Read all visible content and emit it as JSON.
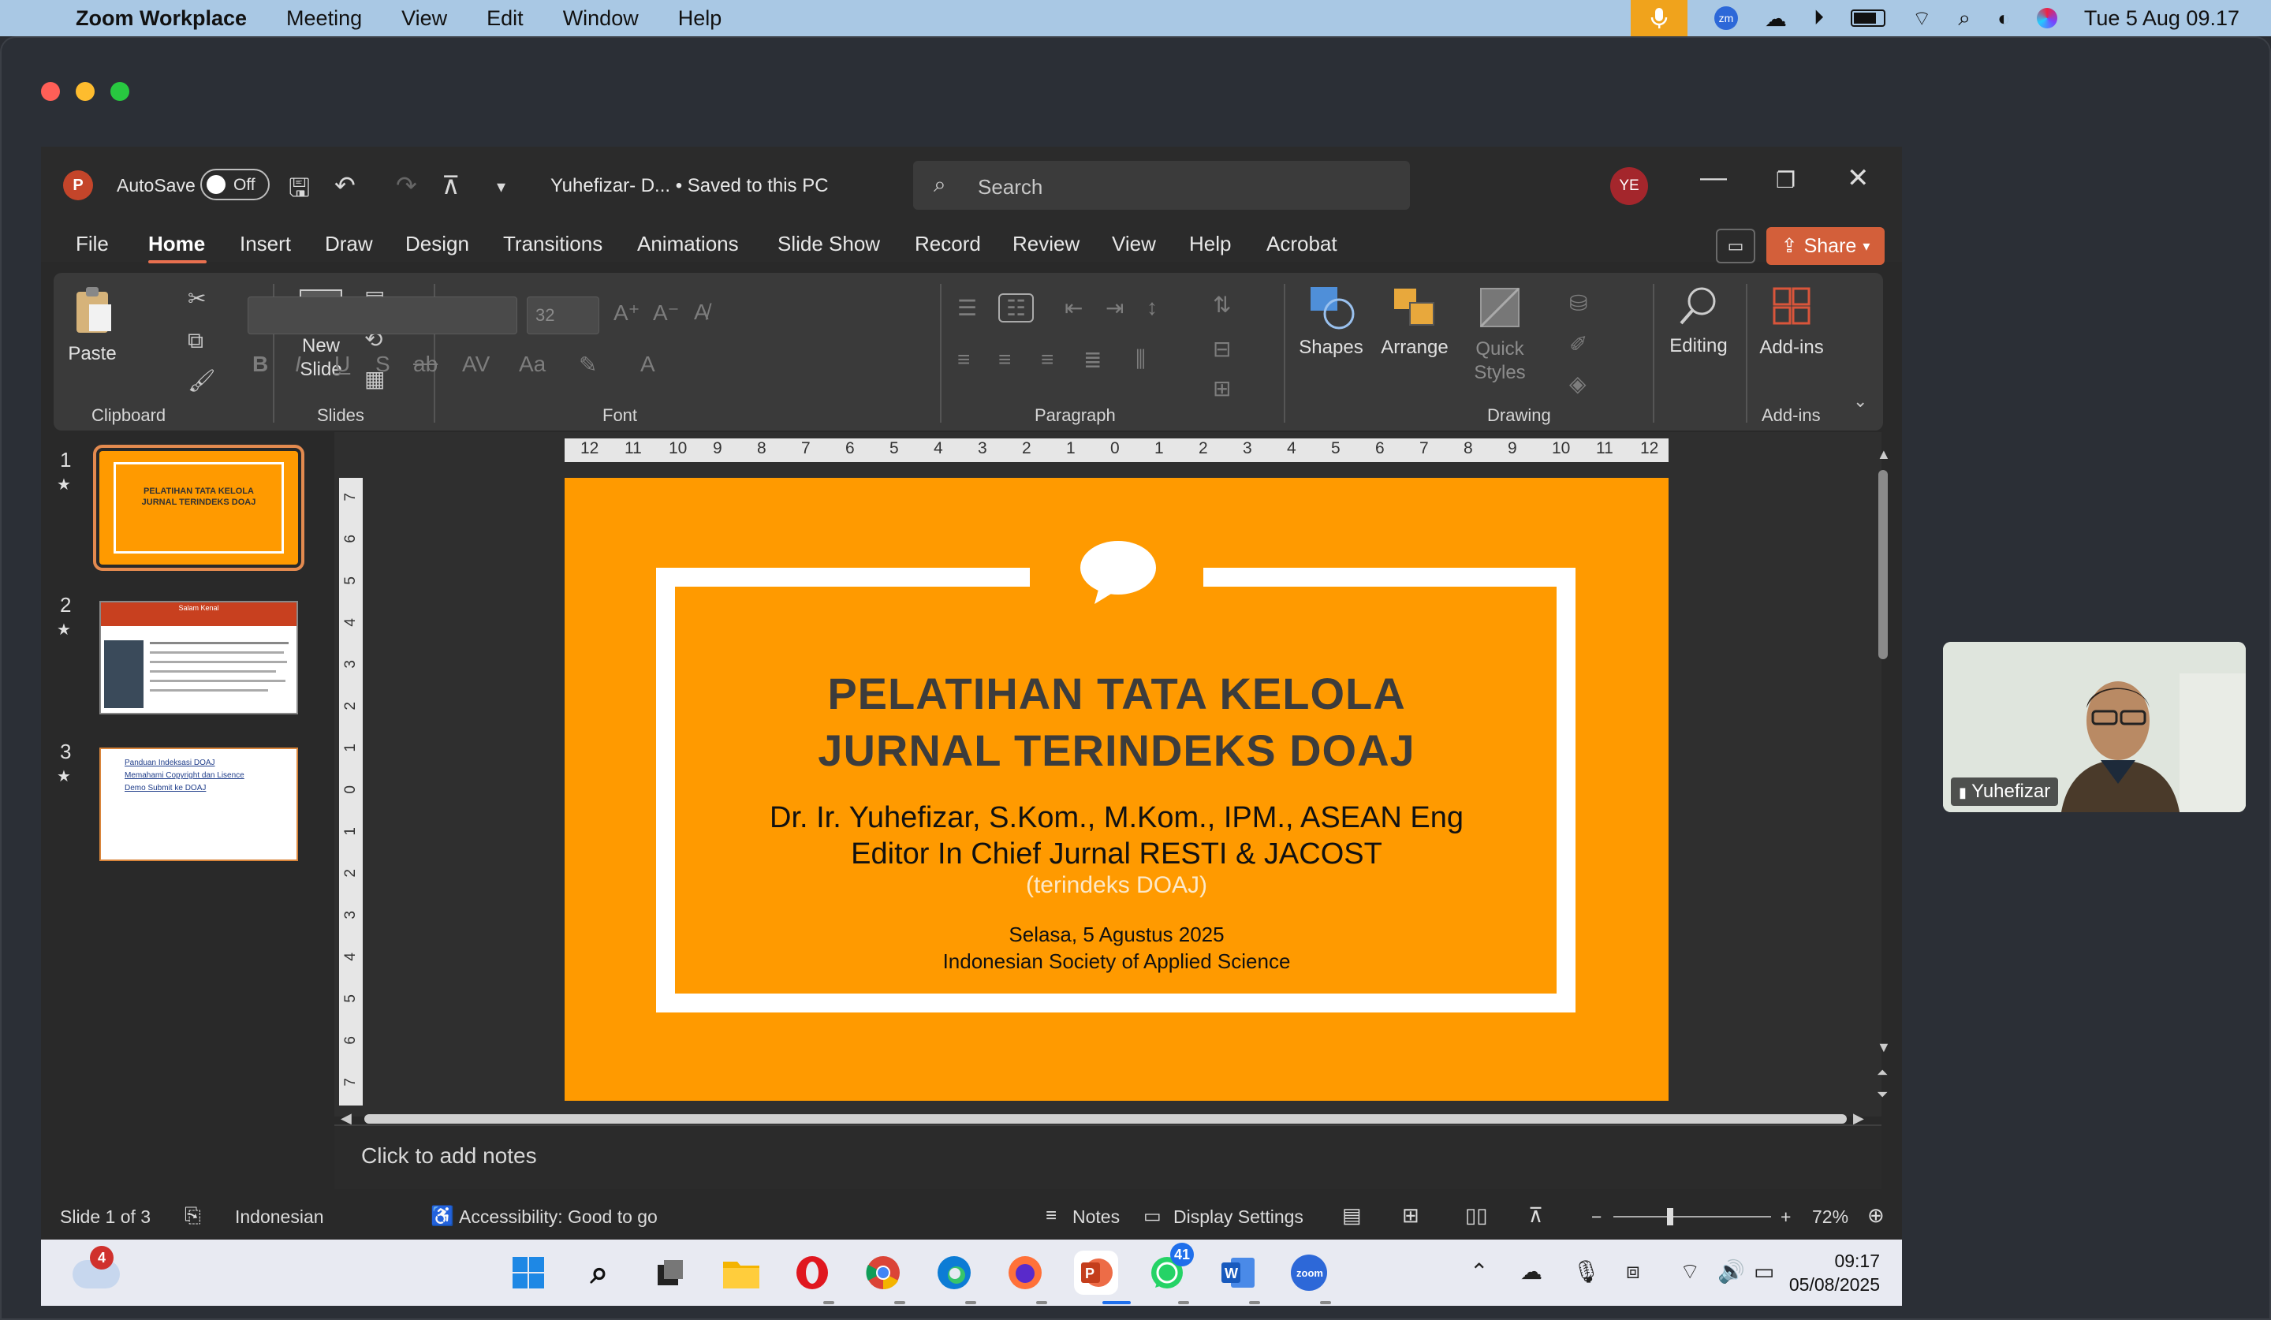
{
  "mac_menubar": {
    "app": "Zoom Workplace",
    "menus": [
      "Meeting",
      "View",
      "Edit",
      "Window",
      "Help"
    ],
    "datetime": "Tue 5 Aug  09.17"
  },
  "ppt": {
    "logo_letter": "P",
    "autosave_label": "AutoSave",
    "autosave_state": "Off",
    "doc_title": "Yuhefizar- D...  •  Saved to this PC",
    "search_placeholder": "Search",
    "user_initials": "YE",
    "tabs": [
      "File",
      "Home",
      "Insert",
      "Draw",
      "Design",
      "Transitions",
      "Animations",
      "Slide Show",
      "Record",
      "Review",
      "View",
      "Help",
      "Acrobat"
    ],
    "share_label": "Share",
    "ribbon": {
      "paste": "Paste",
      "new_slide": "New\nSlide",
      "font_size": "32",
      "shapes": "Shapes",
      "arrange": "Arrange",
      "quick_styles": "Quick\nStyles",
      "editing": "Editing",
      "addins": "Add-ins",
      "groups": {
        "clipboard": "Clipboard",
        "slides": "Slides",
        "font": "Font",
        "paragraph": "Paragraph",
        "drawing": "Drawing",
        "addins": "Add-ins"
      }
    },
    "thumbnails": [
      {
        "num": "1",
        "star": "★",
        "title": "PELATIHAN TATA KELOLA\nJURNAL TERINDEKS DOAJ"
      },
      {
        "num": "2",
        "star": "★",
        "title": "Salam Kenal"
      },
      {
        "num": "3",
        "star": "★",
        "items": [
          "Panduan Indeksasi DOAJ",
          "Memahami Copyright dan Lisence",
          "Demo Submit ke DOAJ"
        ]
      }
    ],
    "ruler_h": [
      "12",
      "11",
      "10",
      "9",
      "8",
      "7",
      "6",
      "5",
      "4",
      "3",
      "2",
      "1",
      "0",
      "1",
      "2",
      "3",
      "4",
      "5",
      "6",
      "7",
      "8",
      "9",
      "10",
      "11",
      "12"
    ],
    "ruler_v": [
      "7",
      "6",
      "5",
      "4",
      "3",
      "2",
      "1",
      "0",
      "1",
      "2",
      "3",
      "4",
      "5",
      "6",
      "7"
    ],
    "slide": {
      "title_line1": "PELATIHAN TATA KELOLA",
      "title_line2": "JURNAL TERINDEKS DOAJ",
      "author": "Dr. Ir. Yuhefizar, S.Kom., M.Kom., IPM., ASEAN Eng",
      "role": "Editor In Chief Jurnal RESTI & JACOST",
      "indexed": "(terindeks DOAJ)",
      "date": "Selasa, 5 Agustus 2025",
      "org": "Indonesian Society of Applied Science"
    },
    "notes_placeholder": "Click to add notes",
    "status": {
      "slide_info": "Slide 1 of 3",
      "language": "Indonesian",
      "accessibility": "Accessibility: Good to go",
      "notes": "Notes",
      "display_settings": "Display Settings",
      "zoom": "72%"
    }
  },
  "taskbar": {
    "weather_badge": "4",
    "whatsapp_badge": "41",
    "time": "09:17",
    "date": "05/08/2025"
  },
  "video": {
    "participant_name": "Yuhefizar"
  },
  "colors": {
    "slide_orange": "#ff9a00",
    "accent_tab": "#e8704f",
    "share": "#d35f3a"
  }
}
